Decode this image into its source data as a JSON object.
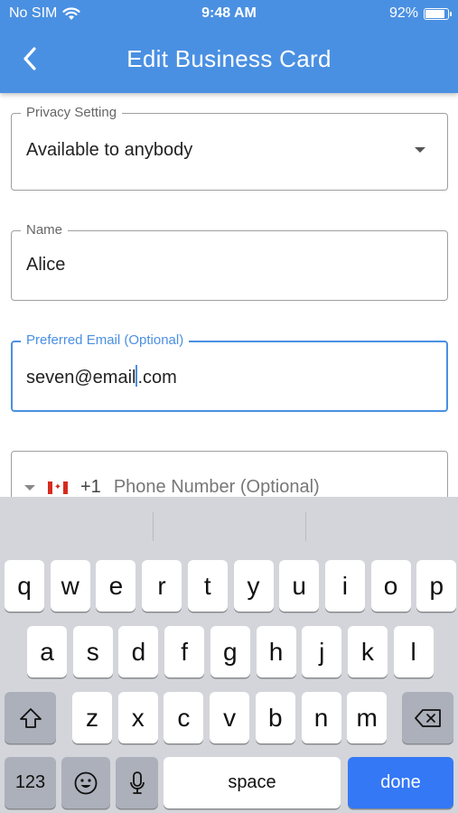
{
  "status_bar": {
    "carrier": "No SIM",
    "time": "9:48 AM",
    "battery_percent": "92%",
    "battery_level": 0.92
  },
  "header": {
    "title": "Edit Business Card",
    "background_color": "#4a90e2"
  },
  "form": {
    "privacy": {
      "label": "Privacy Setting",
      "value": "Available to anybody"
    },
    "name": {
      "label": "Name",
      "value": "Alice"
    },
    "email": {
      "label": "Preferred Email (Optional)",
      "value_before_caret": "seven@email",
      "value_after_caret": ".com"
    },
    "phone": {
      "country_code": "+1",
      "placeholder": "Phone Number (Optional)",
      "flag": "canada-flag-icon"
    }
  },
  "keyboard": {
    "row1": [
      "q",
      "w",
      "e",
      "r",
      "t",
      "y",
      "u",
      "i",
      "o",
      "p"
    ],
    "row2": [
      "a",
      "s",
      "d",
      "f",
      "g",
      "h",
      "j",
      "k",
      "l"
    ],
    "row3": [
      "z",
      "x",
      "c",
      "v",
      "b",
      "n",
      "m"
    ],
    "numbers_key": "123",
    "space_key": "space",
    "done_key": "done",
    "done_color": "#3478f6"
  }
}
